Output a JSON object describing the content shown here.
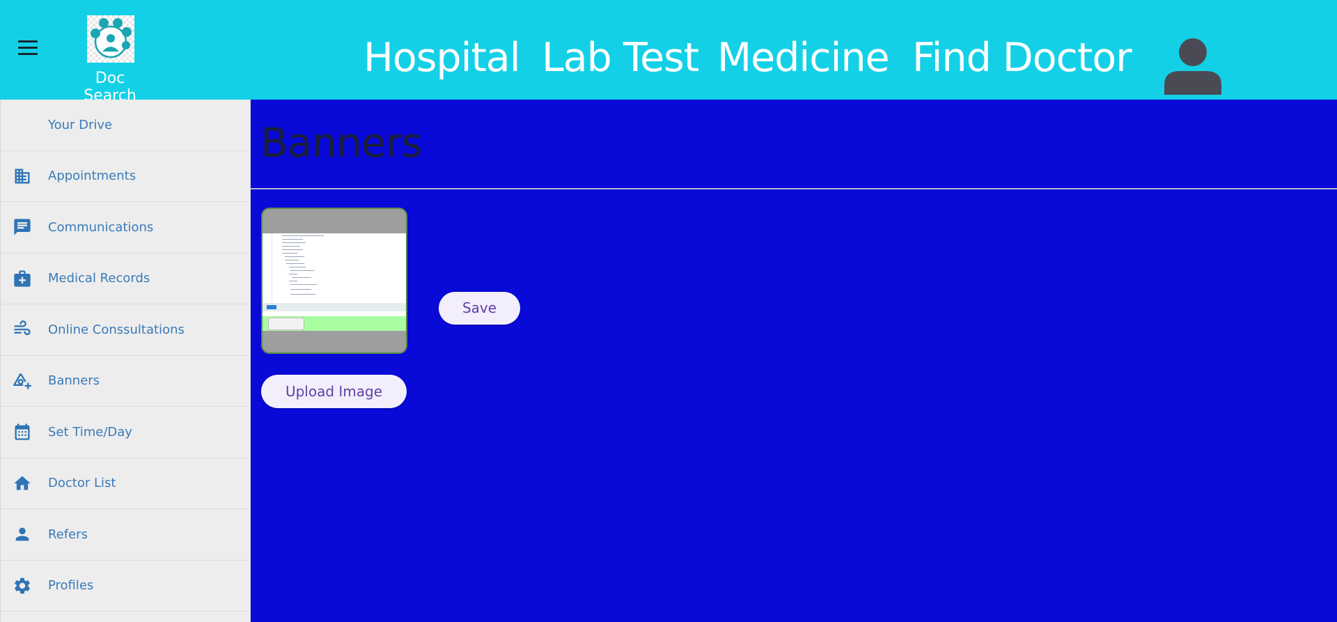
{
  "app": {
    "name": "Doc Search"
  },
  "topnav": {
    "items": [
      "Hospital",
      "Lab Test",
      "Medicine",
      "Find Doctor"
    ]
  },
  "sidebar": {
    "items": [
      {
        "label": "Your Drive",
        "icon": "none"
      },
      {
        "label": "Appointments",
        "icon": "building-icon"
      },
      {
        "label": "Communications",
        "icon": "chat-icon"
      },
      {
        "label": "Medical Records",
        "icon": "medical-kit-icon"
      },
      {
        "label": "Online Conssultations",
        "icon": "wind-icon"
      },
      {
        "label": "Banners",
        "icon": "shapes-add-icon"
      },
      {
        "label": "Set Time/Day",
        "icon": "calendar-icon"
      },
      {
        "label": "Doctor List",
        "icon": "home-icon"
      },
      {
        "label": "Refers",
        "icon": "person-icon"
      },
      {
        "label": "Profiles",
        "icon": "gear-icon"
      }
    ]
  },
  "main": {
    "title": "Banners",
    "save_label": "Save",
    "upload_label": "Upload Image"
  },
  "colors": {
    "header": "#13d0e6",
    "main_bg": "#0909d8",
    "sidebar_bg": "#ededed",
    "sidebar_text": "#3a7ab8",
    "button_text": "#5e3fa8",
    "button_bg": "#f3eefb"
  }
}
